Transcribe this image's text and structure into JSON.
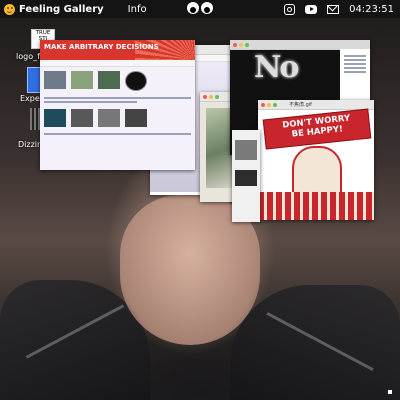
{
  "app": {
    "title": "Feeling Gallery",
    "menu_info": "Info"
  },
  "status": {
    "clock": "04:23:51"
  },
  "icons": {
    "smiley": "smiley-face-icon",
    "eyes": "eyes-icon",
    "instagram": "instagram-icon",
    "youtube": "youtube-icon",
    "mail": "mail-icon"
  },
  "desktop": {
    "true_still": "TRUE STI",
    "items": [
      {
        "label": "logo_fi"
      },
      {
        "label": "Exper"
      },
      {
        "label": "Dizzine"
      }
    ]
  },
  "windows": {
    "arbitrary": {
      "title": "MAKE ARBITRARY DECISIONS"
    },
    "poster": {
      "title": "不焦虑.gif",
      "banner_line1": "DON'T WORRY",
      "banner_line2": "BE HAPPY!"
    },
    "no": {
      "word": "No"
    }
  },
  "colors": {
    "accent_red": "#d9352f",
    "topbar": "#141414"
  }
}
